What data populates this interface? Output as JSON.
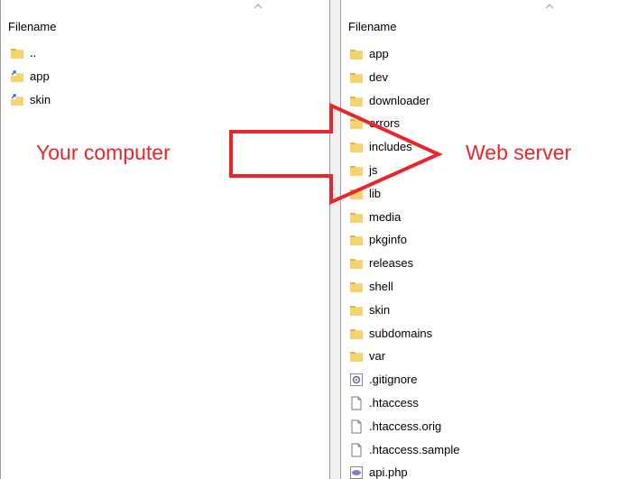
{
  "local": {
    "header": "Filename",
    "items": [
      {
        "name": "..",
        "icon": "folder-icon"
      },
      {
        "name": "app",
        "icon": "folder-shortcut-icon"
      },
      {
        "name": "skin",
        "icon": "folder-shortcut-icon"
      }
    ]
  },
  "remote": {
    "header": "Filename",
    "items": [
      {
        "name": "app",
        "icon": "folder-icon"
      },
      {
        "name": "dev",
        "icon": "folder-icon"
      },
      {
        "name": "downloader",
        "icon": "folder-icon"
      },
      {
        "name": "errors",
        "icon": "folder-icon"
      },
      {
        "name": "includes",
        "icon": "folder-icon"
      },
      {
        "name": "js",
        "icon": "folder-icon"
      },
      {
        "name": "lib",
        "icon": "folder-icon"
      },
      {
        "name": "media",
        "icon": "folder-icon"
      },
      {
        "name": "pkginfo",
        "icon": "folder-icon"
      },
      {
        "name": "releases",
        "icon": "folder-icon"
      },
      {
        "name": "shell",
        "icon": "folder-icon"
      },
      {
        "name": "skin",
        "icon": "folder-icon"
      },
      {
        "name": "subdomains",
        "icon": "folder-icon"
      },
      {
        "name": "var",
        "icon": "folder-icon"
      },
      {
        "name": ".gitignore",
        "icon": "settings-file-icon"
      },
      {
        "name": ".htaccess",
        "icon": "file-icon"
      },
      {
        "name": ".htaccess.orig",
        "icon": "file-icon"
      },
      {
        "name": ".htaccess.sample",
        "icon": "file-icon"
      },
      {
        "name": "api.php",
        "icon": "php-file-icon"
      }
    ]
  },
  "annotations": {
    "left": "Your computer",
    "right": "Web server"
  },
  "colors": {
    "annotation": "#e8262b",
    "folder": "#f5d36e",
    "folder_dark": "#e0b44a",
    "shortcut": "#1e73c8"
  }
}
